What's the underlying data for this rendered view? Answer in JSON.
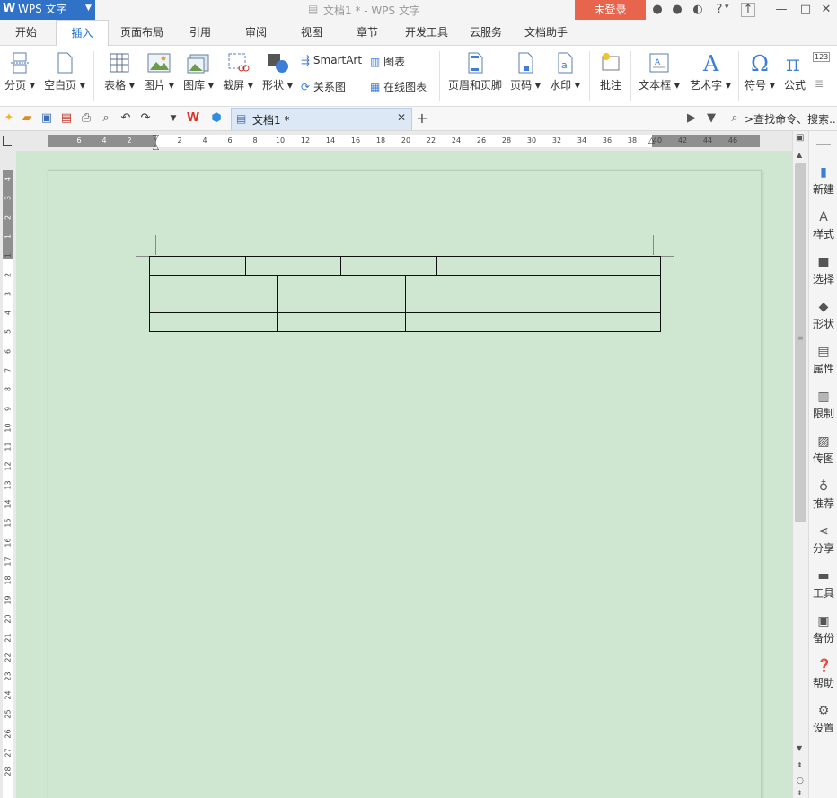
{
  "titlebar": {
    "app_name": "WPS 文字",
    "doc_title": "文档1 * - WPS 文字",
    "login_label": "未登录",
    "help_label": "?"
  },
  "tabs": [
    "开始",
    "插入",
    "页面布局",
    "引用",
    "审阅",
    "视图",
    "章节",
    "开发工具",
    "云服务",
    "文档助手"
  ],
  "active_tab": "插入",
  "ribbon": {
    "page_break": "分页",
    "blank_page": "空白页",
    "table": "表格",
    "picture": "图片",
    "gallery": "图库",
    "screenshot": "截屏",
    "shapes": "形状",
    "smartart": "SmartArt",
    "chart": "图表",
    "relation": "关系图",
    "online_chart": "在线图表",
    "header_footer": "页眉和页脚",
    "page_number": "页码",
    "watermark": "水印",
    "comment": "批注",
    "textbox": "文本框",
    "wordart": "艺术字",
    "symbol": "符号",
    "formula": "公式",
    "num_label": "123"
  },
  "quickbar": {
    "doc_tab": "文档1 *",
    "search_placeholder": "查找命令、搜索..."
  },
  "hruler_labels": [
    "6",
    "4",
    "2",
    "2",
    "4",
    "6",
    "8",
    "10",
    "12",
    "14",
    "16",
    "18",
    "20",
    "22",
    "24",
    "26",
    "28",
    "30",
    "32",
    "34",
    "36",
    "38",
    "40",
    "42",
    "44",
    "46"
  ],
  "vruler_labels": [
    "4",
    "3",
    "2",
    "1",
    "1",
    "2",
    "3",
    "4",
    "5",
    "6",
    "7",
    "8",
    "9",
    "10",
    "11",
    "12",
    "13",
    "14",
    "15",
    "16",
    "17",
    "18",
    "19",
    "20",
    "21",
    "22",
    "23",
    "24",
    "25",
    "26",
    "27",
    "28"
  ],
  "side_panel": [
    "新建",
    "样式",
    "选择",
    "形状",
    "属性",
    "限制",
    "传图",
    "推荐",
    "分享",
    "工具",
    "备份",
    "帮助",
    "设置"
  ],
  "colors": {
    "app_blue": "#2f72c8",
    "login_red": "#e8654d",
    "canvas_green": "#cfe7d1",
    "active_tab_text": "#1d6fd1"
  }
}
